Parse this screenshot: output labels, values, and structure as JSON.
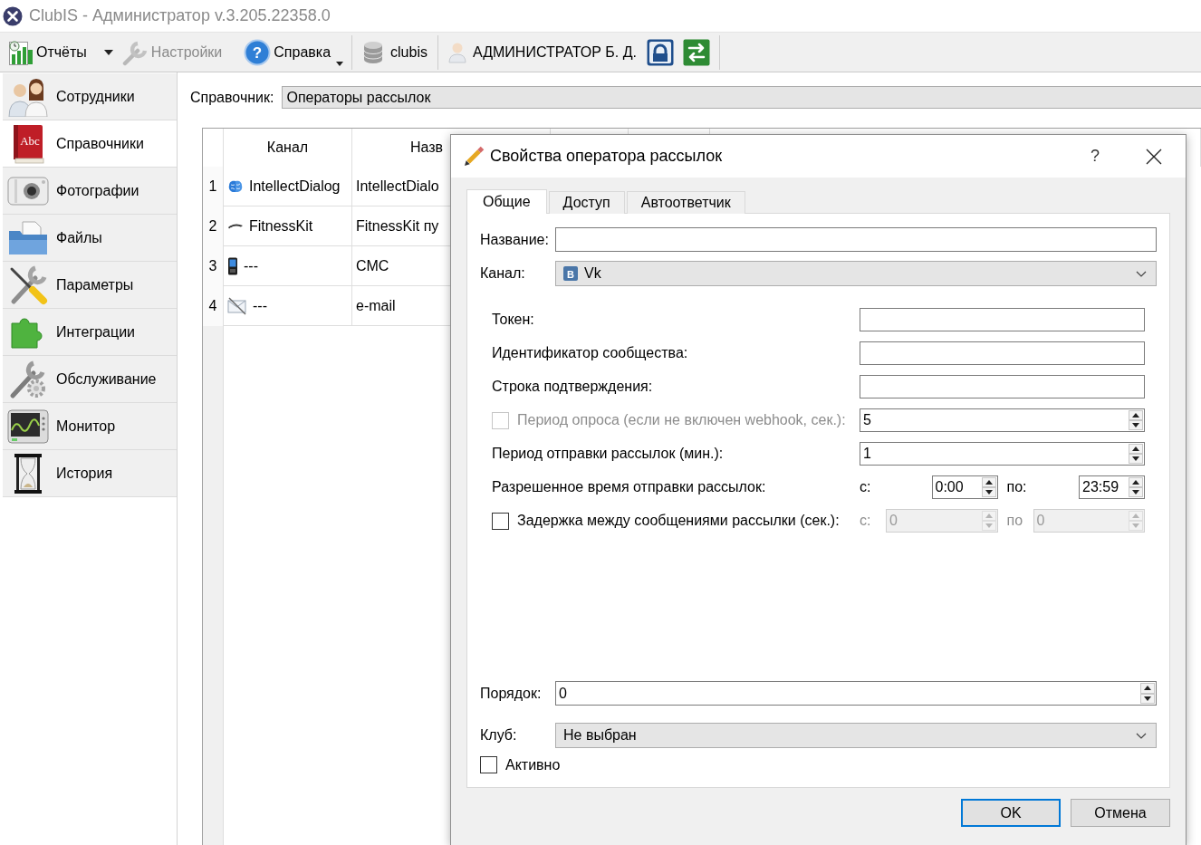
{
  "window": {
    "title": "ClubIS - Администратор v.3.205.22358.0"
  },
  "toolbar": {
    "items": [
      {
        "kind": "split-button",
        "label": "Отчёты",
        "disabled": false
      },
      {
        "kind": "button",
        "label": "Настройки",
        "disabled": true
      },
      {
        "kind": "menu-button",
        "label": "Справка",
        "disabled": false,
        "icon_text": "?"
      },
      {
        "kind": "separator"
      },
      {
        "kind": "label",
        "label": "clubis"
      },
      {
        "kind": "separator"
      },
      {
        "kind": "label",
        "label": "АДМИНИСТРАТОР Б. Д."
      },
      {
        "kind": "icon-button",
        "disabled": false
      },
      {
        "kind": "icon-button",
        "disabled": false
      },
      {
        "kind": "separator"
      }
    ]
  },
  "sidebar": {
    "items": [
      {
        "label": "Сотрудники",
        "selected": false
      },
      {
        "label": "Справочники",
        "selected": true,
        "icon_text": "Abc"
      },
      {
        "label": "Фотографии",
        "selected": false
      },
      {
        "label": "Файлы",
        "selected": false
      },
      {
        "label": "Параметры",
        "selected": false
      },
      {
        "label": "Интеграции",
        "selected": false
      },
      {
        "label": "Обслуживание",
        "selected": false
      },
      {
        "label": "Монитор",
        "selected": false
      },
      {
        "label": "История",
        "selected": false
      }
    ]
  },
  "directory": {
    "label": "Справочник:",
    "value": "Операторы рассылок"
  },
  "table": {
    "columns": [
      "Канал",
      "Назв"
    ],
    "rows": [
      {
        "number": "1",
        "channel": "IntellectDialog",
        "name": "IntellectDialo"
      },
      {
        "number": "2",
        "channel": "FitnessKit",
        "name": "FitnessKit пу"
      },
      {
        "number": "3",
        "channel": "---",
        "name": "СМС"
      },
      {
        "number": "4",
        "channel": "---",
        "name": "e-mail"
      }
    ]
  },
  "dialog": {
    "title": "Свойства оператора рассылок",
    "help": "?",
    "tabs": [
      {
        "label": "Общие",
        "selected": true
      },
      {
        "label": "Доступ",
        "selected": false
      },
      {
        "label": "Автоответчик",
        "selected": false
      }
    ],
    "fields": [
      {
        "kind": "text",
        "label": "Название:"
      },
      {
        "kind": "combo",
        "label": "Канал:",
        "value": "Vk",
        "icon_text": "В"
      }
    ],
    "settings": [
      {
        "kind": "text",
        "label": "Токен:"
      },
      {
        "kind": "text",
        "label": "Идентификатор сообщества:"
      },
      {
        "kind": "text",
        "label": "Строка подтверждения:"
      },
      {
        "kind": "check-spin",
        "label": "Период опроса (если не включен webhook, сек.):",
        "checked": false,
        "disabled": true,
        "value": "5"
      },
      {
        "kind": "spin",
        "label": "Период отправки рассылок (мин.):",
        "value": "1"
      },
      {
        "kind": "range",
        "label": "Разрешенное время отправки рассылок:",
        "range": {
          "from_label": "с:",
          "from": "0:00",
          "to_label": "по:",
          "to": "23:59",
          "disabled": false
        }
      },
      {
        "kind": "check-range",
        "label": "Задержка между сообщениями рассылки (сек.):",
        "checked": false,
        "range": {
          "from_label": "с:",
          "from": "0",
          "to_label": "по",
          "to": "0",
          "disabled": true
        }
      }
    ],
    "extra_fields": [
      {
        "kind": "spin",
        "label": "Порядок:",
        "value": "0"
      },
      {
        "kind": "combo",
        "label": "Клуб:",
        "value": "Не выбран"
      },
      {
        "kind": "check",
        "label": "Активно",
        "checked": false
      }
    ],
    "buttons": [
      {
        "label": "OK",
        "default": true
      },
      {
        "label": "Отмена",
        "default": false
      }
    ]
  }
}
